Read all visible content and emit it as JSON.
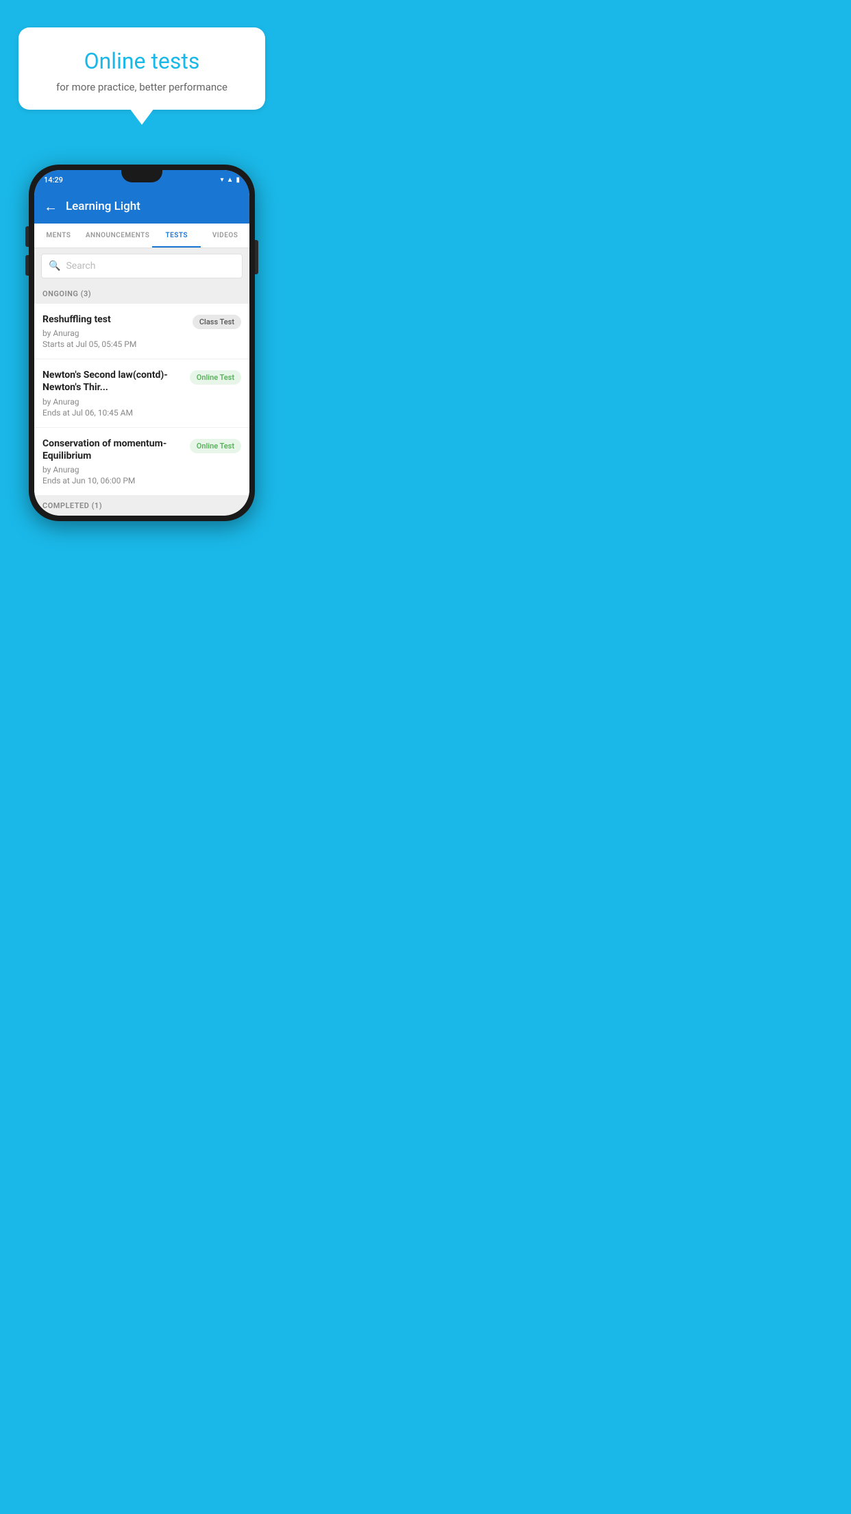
{
  "background_color": "#1ab8e8",
  "speech_bubble": {
    "title": "Online tests",
    "subtitle": "for more practice, better performance"
  },
  "phone": {
    "status_bar": {
      "time": "14:29",
      "icons": [
        "wifi",
        "signal",
        "battery"
      ]
    },
    "app_bar": {
      "title": "Learning Light",
      "back_label": "←"
    },
    "tabs": [
      {
        "label": "MENTS",
        "active": false
      },
      {
        "label": "ANNOUNCEMENTS",
        "active": false
      },
      {
        "label": "TESTS",
        "active": true
      },
      {
        "label": "VIDEOS",
        "active": false
      }
    ],
    "search": {
      "placeholder": "Search"
    },
    "ongoing_section": {
      "label": "ONGOING (3)"
    },
    "tests": [
      {
        "title": "Reshuffling test",
        "by": "by Anurag",
        "date": "Starts at  Jul 05, 05:45 PM",
        "badge": "Class Test",
        "badge_type": "class"
      },
      {
        "title": "Newton's Second law(contd)-Newton's Thir...",
        "by": "by Anurag",
        "date": "Ends at  Jul 06, 10:45 AM",
        "badge": "Online Test",
        "badge_type": "online"
      },
      {
        "title": "Conservation of momentum-Equilibrium",
        "by": "by Anurag",
        "date": "Ends at  Jun 10, 06:00 PM",
        "badge": "Online Test",
        "badge_type": "online"
      }
    ],
    "completed_section": {
      "label": "COMPLETED (1)"
    }
  }
}
